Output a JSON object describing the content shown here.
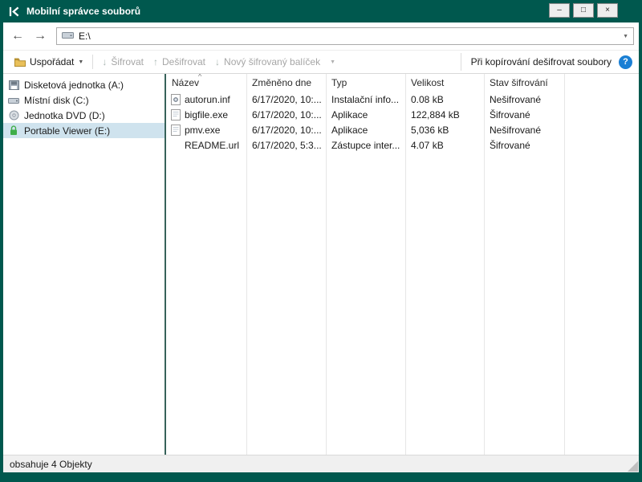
{
  "window": {
    "title": "Mobilní správce souborů",
    "controls": {
      "minimize": "–",
      "maximize": "□",
      "close": "×"
    }
  },
  "navigation": {
    "back_glyph": "←",
    "forward_glyph": "→",
    "address": "E:\\",
    "dropdown_glyph": "▼"
  },
  "toolbar": {
    "organize": "Uspořádat",
    "organize_caret": "▼",
    "encrypt": "Šifrovat",
    "encrypt_glyph": "↓",
    "decrypt": "Dešifrovat",
    "decrypt_glyph": "↑",
    "new_package": "Nový šifrovaný balíček",
    "new_package_glyph": "↓",
    "new_package_caret": "▼",
    "decrypt_on_copy": "Při kopírování dešifrovat soubory",
    "help_glyph": "?"
  },
  "sidebar": {
    "items": [
      {
        "label": "Disketová jednotka (A:)",
        "icon": "floppy-drive-icon"
      },
      {
        "label": "Místní disk (C:)",
        "icon": "hard-disk-icon"
      },
      {
        "label": "Jednotka DVD (D:)",
        "icon": "dvd-drive-icon"
      },
      {
        "label": "Portable Viewer (E:)",
        "icon": "lock-icon"
      }
    ],
    "selected_index": 3
  },
  "file_list": {
    "columns": [
      "Název",
      "Změněno dne",
      "Typ",
      "Velikost",
      "Stav šifrování"
    ],
    "sort_indicator": "^",
    "rows": [
      {
        "name": "autorun.inf",
        "modified": "6/17/2020, 10:...",
        "type": "Instalační info...",
        "size": "0.08 kB",
        "status": "Nešifrované"
      },
      {
        "name": "bigfile.exe",
        "modified": "6/17/2020, 10:...",
        "type": "Aplikace",
        "size": "122,884 kB",
        "status": "Šifrované"
      },
      {
        "name": "pmv.exe",
        "modified": "6/17/2020, 10:...",
        "type": "Aplikace",
        "size": "5,036 kB",
        "status": "Nešifrované"
      },
      {
        "name": "README.url",
        "modified": "6/17/2020, 5:3...",
        "type": "Zástupce inter...",
        "size": "4.07 kB",
        "status": "Šifrované"
      }
    ]
  },
  "status_bar": {
    "text": "obsahuje 4 Objekty"
  },
  "colors": {
    "titlebar_teal": "#00584e",
    "selection": "#cfe3ee",
    "help_blue": "#1a7fd4",
    "disabled_text": "#a6a6a6",
    "lock_green": "#3fae49"
  }
}
